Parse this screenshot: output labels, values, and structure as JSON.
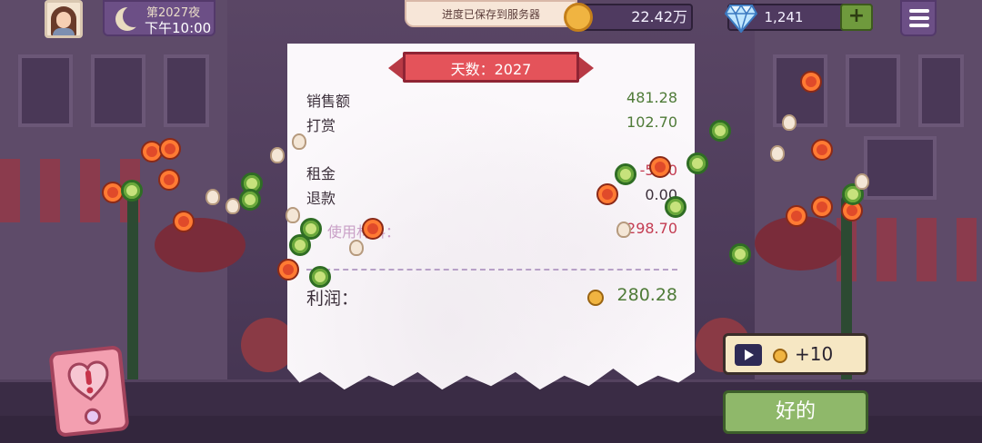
{
  "top_bar": {
    "day_title": "第2027夜",
    "time": "下午10:00",
    "toast": "进度已保存到服务器",
    "coins": "22.42万",
    "gems": "1,241",
    "plus": "+"
  },
  "receipt": {
    "ribbon": "天数：2027",
    "rows": [
      {
        "label": "销售额",
        "value": "481.28"
      },
      {
        "label": "打赏",
        "value": "102.70"
      },
      {
        "label": "租金",
        "value": "-5.00"
      },
      {
        "label": "退款",
        "value": "0.00"
      },
      {
        "label": "使用材料：",
        "value": "-298.70"
      }
    ],
    "profit_label": "利润：",
    "profit_value": "280.28"
  },
  "buttons": {
    "ad_reward": "+10",
    "ok": "好的"
  },
  "colors": {
    "positive": "#4f7b38",
    "negative": "#c43c52",
    "ok_button": "#8fb86a",
    "ribbon": "#e4535a"
  }
}
